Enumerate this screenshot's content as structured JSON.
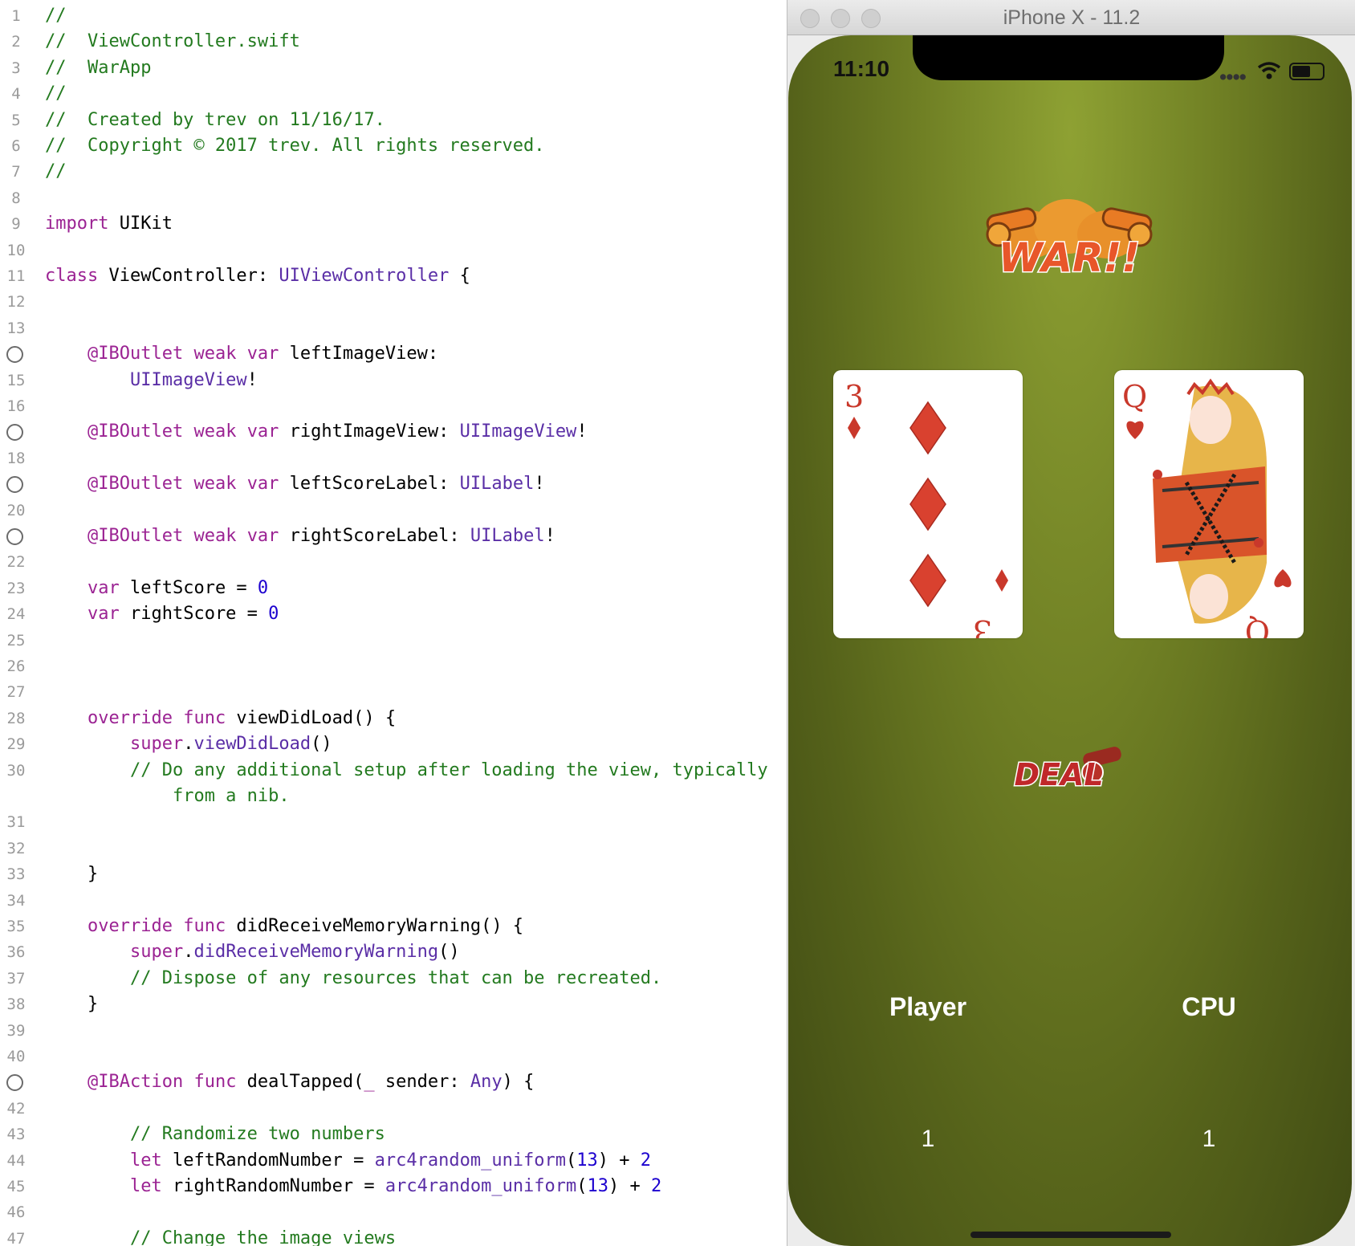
{
  "editor": {
    "lines": [
      {
        "n": "1",
        "breakpoint": false,
        "tokens": [
          {
            "t": "//",
            "c": "cm"
          }
        ]
      },
      {
        "n": "2",
        "breakpoint": false,
        "tokens": [
          {
            "t": "//  ViewController.swift",
            "c": "cm"
          }
        ]
      },
      {
        "n": "3",
        "breakpoint": false,
        "tokens": [
          {
            "t": "//  WarApp",
            "c": "cm"
          }
        ]
      },
      {
        "n": "4",
        "breakpoint": false,
        "tokens": [
          {
            "t": "//",
            "c": "cm"
          }
        ]
      },
      {
        "n": "5",
        "breakpoint": false,
        "tokens": [
          {
            "t": "//  Created by trev on 11/16/17.",
            "c": "cm"
          }
        ]
      },
      {
        "n": "6",
        "breakpoint": false,
        "tokens": [
          {
            "t": "//  Copyright © 2017 trev. All rights reserved.",
            "c": "cm"
          }
        ]
      },
      {
        "n": "7",
        "breakpoint": false,
        "tokens": [
          {
            "t": "//",
            "c": "cm"
          }
        ]
      },
      {
        "n": "8",
        "breakpoint": false,
        "tokens": []
      },
      {
        "n": "9",
        "breakpoint": false,
        "tokens": [
          {
            "t": "import",
            "c": "kw"
          },
          {
            "t": " UIKit",
            "c": ""
          }
        ]
      },
      {
        "n": "10",
        "breakpoint": false,
        "tokens": []
      },
      {
        "n": "11",
        "breakpoint": false,
        "tokens": [
          {
            "t": "class",
            "c": "kw"
          },
          {
            "t": " ViewController: ",
            "c": ""
          },
          {
            "t": "UIViewController",
            "c": "ty"
          },
          {
            "t": " {",
            "c": ""
          }
        ]
      },
      {
        "n": "12",
        "breakpoint": false,
        "tokens": []
      },
      {
        "n": "13",
        "breakpoint": false,
        "tokens": []
      },
      {
        "n": "14",
        "breakpoint": true,
        "tokens": [
          {
            "t": "    ",
            "c": ""
          },
          {
            "t": "@IBOutlet",
            "c": "at"
          },
          {
            "t": " ",
            "c": ""
          },
          {
            "t": "weak",
            "c": "kw"
          },
          {
            "t": " ",
            "c": ""
          },
          {
            "t": "var",
            "c": "kw"
          },
          {
            "t": " leftImageView:",
            "c": ""
          }
        ]
      },
      {
        "n": "15",
        "breakpoint": false,
        "tokens": [
          {
            "t": "        ",
            "c": ""
          },
          {
            "t": "UIImageView",
            "c": "ty"
          },
          {
            "t": "!",
            "c": ""
          }
        ]
      },
      {
        "n": "16",
        "breakpoint": false,
        "tokens": []
      },
      {
        "n": "17",
        "breakpoint": true,
        "tokens": [
          {
            "t": "    ",
            "c": ""
          },
          {
            "t": "@IBOutlet",
            "c": "at"
          },
          {
            "t": " ",
            "c": ""
          },
          {
            "t": "weak",
            "c": "kw"
          },
          {
            "t": " ",
            "c": ""
          },
          {
            "t": "var",
            "c": "kw"
          },
          {
            "t": " rightImageView: ",
            "c": ""
          },
          {
            "t": "UIImageView",
            "c": "ty"
          },
          {
            "t": "!",
            "c": ""
          }
        ]
      },
      {
        "n": "18",
        "breakpoint": false,
        "tokens": []
      },
      {
        "n": "19",
        "breakpoint": true,
        "tokens": [
          {
            "t": "    ",
            "c": ""
          },
          {
            "t": "@IBOutlet",
            "c": "at"
          },
          {
            "t": " ",
            "c": ""
          },
          {
            "t": "weak",
            "c": "kw"
          },
          {
            "t": " ",
            "c": ""
          },
          {
            "t": "var",
            "c": "kw"
          },
          {
            "t": " leftScoreLabel: ",
            "c": ""
          },
          {
            "t": "UILabel",
            "c": "ty"
          },
          {
            "t": "!",
            "c": ""
          }
        ]
      },
      {
        "n": "20",
        "breakpoint": false,
        "tokens": []
      },
      {
        "n": "21",
        "breakpoint": true,
        "tokens": [
          {
            "t": "    ",
            "c": ""
          },
          {
            "t": "@IBOutlet",
            "c": "at"
          },
          {
            "t": " ",
            "c": ""
          },
          {
            "t": "weak",
            "c": "kw"
          },
          {
            "t": " ",
            "c": ""
          },
          {
            "t": "var",
            "c": "kw"
          },
          {
            "t": " rightScoreLabel: ",
            "c": ""
          },
          {
            "t": "UILabel",
            "c": "ty"
          },
          {
            "t": "!",
            "c": ""
          }
        ]
      },
      {
        "n": "22",
        "breakpoint": false,
        "tokens": []
      },
      {
        "n": "23",
        "breakpoint": false,
        "tokens": [
          {
            "t": "    ",
            "c": ""
          },
          {
            "t": "var",
            "c": "kw"
          },
          {
            "t": " leftScore = ",
            "c": ""
          },
          {
            "t": "0",
            "c": "num"
          }
        ]
      },
      {
        "n": "24",
        "breakpoint": false,
        "tokens": [
          {
            "t": "    ",
            "c": ""
          },
          {
            "t": "var",
            "c": "kw"
          },
          {
            "t": " rightScore = ",
            "c": ""
          },
          {
            "t": "0",
            "c": "num"
          }
        ]
      },
      {
        "n": "25",
        "breakpoint": false,
        "tokens": []
      },
      {
        "n": "26",
        "breakpoint": false,
        "tokens": []
      },
      {
        "n": "27",
        "breakpoint": false,
        "tokens": []
      },
      {
        "n": "28",
        "breakpoint": false,
        "tokens": [
          {
            "t": "    ",
            "c": ""
          },
          {
            "t": "override",
            "c": "kw"
          },
          {
            "t": " ",
            "c": ""
          },
          {
            "t": "func",
            "c": "kw"
          },
          {
            "t": " viewDidLoad() {",
            "c": ""
          }
        ]
      },
      {
        "n": "29",
        "breakpoint": false,
        "tokens": [
          {
            "t": "        ",
            "c": ""
          },
          {
            "t": "super",
            "c": "kw"
          },
          {
            "t": ".",
            "c": ""
          },
          {
            "t": "viewDidLoad",
            "c": "ty"
          },
          {
            "t": "()",
            "c": ""
          }
        ]
      },
      {
        "n": "30",
        "breakpoint": false,
        "tokens": [
          {
            "t": "        ",
            "c": ""
          },
          {
            "t": "// Do any additional setup after loading the view, typically",
            "c": "cm"
          }
        ]
      },
      {
        "n": "",
        "breakpoint": false,
        "tokens": [
          {
            "t": "            ",
            "c": ""
          },
          {
            "t": "from a nib.",
            "c": "cm"
          }
        ]
      },
      {
        "n": "31",
        "breakpoint": false,
        "tokens": []
      },
      {
        "n": "32",
        "breakpoint": false,
        "tokens": []
      },
      {
        "n": "33",
        "breakpoint": false,
        "tokens": [
          {
            "t": "    }",
            "c": ""
          }
        ]
      },
      {
        "n": "34",
        "breakpoint": false,
        "tokens": []
      },
      {
        "n": "35",
        "breakpoint": false,
        "tokens": [
          {
            "t": "    ",
            "c": ""
          },
          {
            "t": "override",
            "c": "kw"
          },
          {
            "t": " ",
            "c": ""
          },
          {
            "t": "func",
            "c": "kw"
          },
          {
            "t": " didReceiveMemoryWarning() {",
            "c": ""
          }
        ]
      },
      {
        "n": "36",
        "breakpoint": false,
        "tokens": [
          {
            "t": "        ",
            "c": ""
          },
          {
            "t": "super",
            "c": "kw"
          },
          {
            "t": ".",
            "c": ""
          },
          {
            "t": "didReceiveMemoryWarning",
            "c": "ty"
          },
          {
            "t": "()",
            "c": ""
          }
        ]
      },
      {
        "n": "37",
        "breakpoint": false,
        "tokens": [
          {
            "t": "        ",
            "c": ""
          },
          {
            "t": "// Dispose of any resources that can be recreated.",
            "c": "cm"
          }
        ]
      },
      {
        "n": "38",
        "breakpoint": false,
        "tokens": [
          {
            "t": "    }",
            "c": ""
          }
        ]
      },
      {
        "n": "39",
        "breakpoint": false,
        "tokens": []
      },
      {
        "n": "40",
        "breakpoint": false,
        "tokens": []
      },
      {
        "n": "41",
        "breakpoint": true,
        "tokens": [
          {
            "t": "    ",
            "c": ""
          },
          {
            "t": "@IBAction",
            "c": "at"
          },
          {
            "t": " ",
            "c": ""
          },
          {
            "t": "func",
            "c": "kw"
          },
          {
            "t": " dealTapped(",
            "c": ""
          },
          {
            "t": "_",
            "c": "kw"
          },
          {
            "t": " sender: ",
            "c": ""
          },
          {
            "t": "Any",
            "c": "ty"
          },
          {
            "t": ") {",
            "c": ""
          }
        ]
      },
      {
        "n": "42",
        "breakpoint": false,
        "tokens": []
      },
      {
        "n": "43",
        "breakpoint": false,
        "tokens": [
          {
            "t": "        ",
            "c": ""
          },
          {
            "t": "// Randomize two numbers",
            "c": "cm"
          }
        ]
      },
      {
        "n": "44",
        "breakpoint": false,
        "tokens": [
          {
            "t": "        ",
            "c": ""
          },
          {
            "t": "let",
            "c": "kw"
          },
          {
            "t": " leftRandomNumber = ",
            "c": ""
          },
          {
            "t": "arc4random_uniform",
            "c": "ty"
          },
          {
            "t": "(",
            "c": ""
          },
          {
            "t": "13",
            "c": "num"
          },
          {
            "t": ") + ",
            "c": ""
          },
          {
            "t": "2",
            "c": "num"
          }
        ]
      },
      {
        "n": "45",
        "breakpoint": false,
        "tokens": [
          {
            "t": "        ",
            "c": ""
          },
          {
            "t": "let",
            "c": "kw"
          },
          {
            "t": " rightRandomNumber = ",
            "c": ""
          },
          {
            "t": "arc4random_uniform",
            "c": "ty"
          },
          {
            "t": "(",
            "c": ""
          },
          {
            "t": "13",
            "c": "num"
          },
          {
            "t": ") + ",
            "c": ""
          },
          {
            "t": "2",
            "c": "num"
          }
        ]
      },
      {
        "n": "46",
        "breakpoint": false,
        "tokens": []
      },
      {
        "n": "47",
        "breakpoint": false,
        "tokens": [
          {
            "t": "        ",
            "c": ""
          },
          {
            "t": "// Change the image views",
            "c": "cm"
          }
        ]
      }
    ]
  },
  "simulator": {
    "title": "iPhone X - 11.2",
    "status_time": "11:10",
    "logo_text": "WAR!!",
    "left_card": {
      "rank": "3",
      "suit": "♦"
    },
    "right_card": {
      "rank": "Q",
      "suit": "♥"
    },
    "deal_label": "DEAL",
    "player_label": "Player",
    "cpu_label": "CPU",
    "player_score": "1",
    "cpu_score": "1"
  },
  "colors": {
    "comment": "#237a1f",
    "keyword": "#9b2393",
    "type": "#5a2ea6",
    "number": "#1c00cf",
    "card_red": "#c9382b",
    "felt_green": "#6f7f24"
  }
}
